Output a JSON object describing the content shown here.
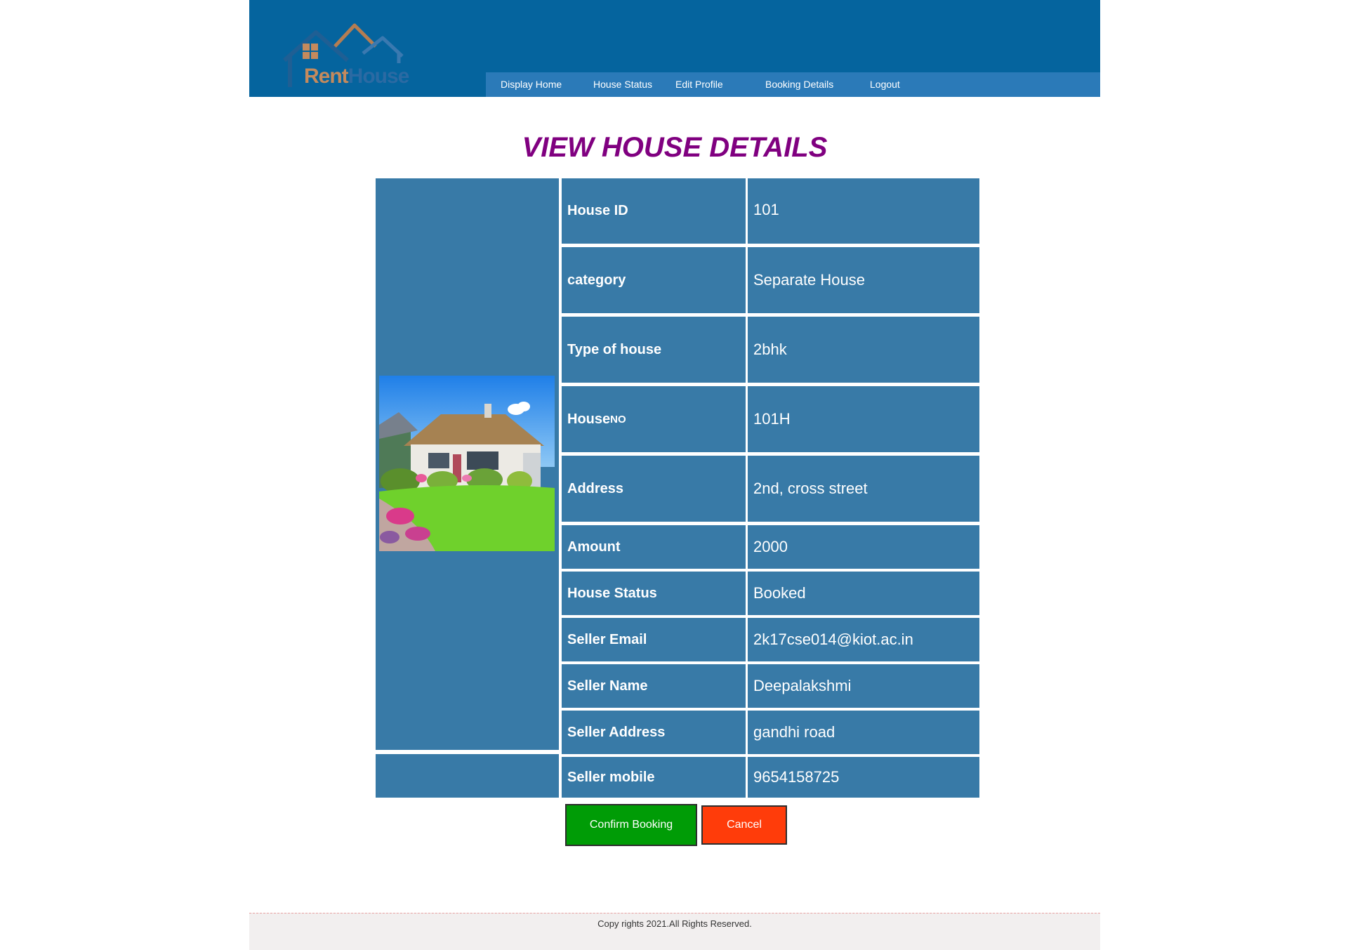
{
  "logo": {
    "text_part1": "Rent",
    "text_part2": "House"
  },
  "nav": {
    "items": [
      "Display Home",
      "House Status",
      "Edit Profile",
      "Booking Details",
      "Logout"
    ]
  },
  "page_title": "VIEW HOUSE DETAILS",
  "details": {
    "house_id_label": "House ID",
    "house_id": "101",
    "category_label": "category",
    "category": "Separate House",
    "type_label": "Type of house",
    "type": "2bhk",
    "house_no_label_main": "House",
    "house_no_label_small": "NO",
    "house_no": "101H",
    "address_label": "Address",
    "address": "2nd, cross street",
    "amount_label": "Amount",
    "amount": "2000",
    "status_label": "House Status",
    "status": "Booked",
    "seller_email_label": "Seller Email",
    "seller_email": "2k17cse014@kiot.ac.in",
    "seller_name_label": "Seller Name",
    "seller_name": "Deepalakshmi",
    "seller_address_label": "Seller Address",
    "seller_address": "gandhi road",
    "seller_mobile_label": "Seller mobile",
    "seller_mobile": "9654158725"
  },
  "buttons": {
    "confirm": "Confirm Booking",
    "cancel": "Cancel"
  },
  "footer": {
    "text": "Copy rights 2021.All Rights Reserved."
  },
  "colors": {
    "header_bg": "#05649e",
    "nav_bg": "#2b7ab8",
    "table_cell": "#387aa7",
    "title": "#800080",
    "confirm": "#009c06",
    "cancel": "#ff3c0a"
  }
}
